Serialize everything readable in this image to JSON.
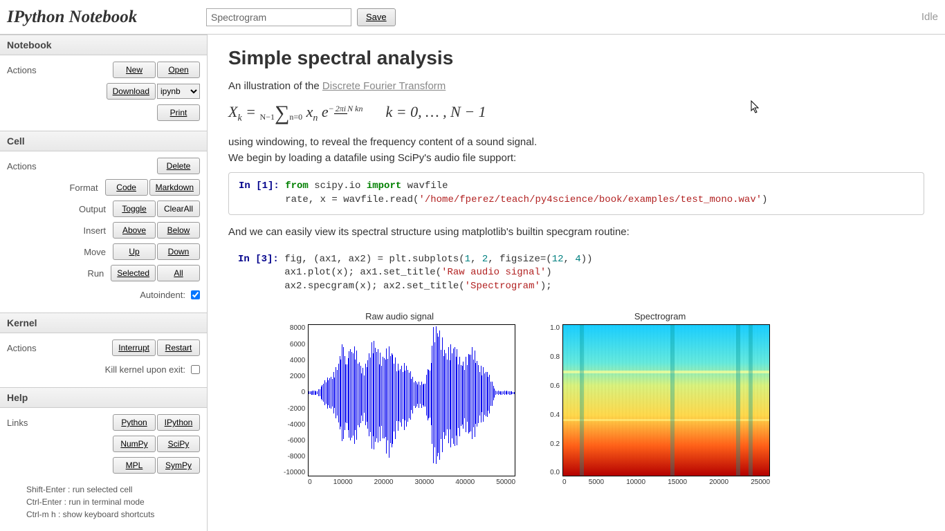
{
  "header": {
    "logo": "IPython Notebook",
    "title_value": "Spectrogram",
    "save_label": "Save",
    "status": "Idle"
  },
  "sidebar": {
    "notebook": {
      "header": "Notebook",
      "actions_label": "Actions",
      "new_label": "New",
      "open_label": "Open",
      "download_label": "Download",
      "download_format": "ipynb",
      "print_label": "Print"
    },
    "cell": {
      "header": "Cell",
      "actions_label": "Actions",
      "delete_label": "Delete",
      "format_label": "Format",
      "code_label": "Code",
      "markdown_label": "Markdown",
      "output_label": "Output",
      "toggle_label": "Toggle",
      "clearall_label": "ClearAll",
      "insert_label": "Insert",
      "above_label": "Above",
      "below_label": "Below",
      "move_label": "Move",
      "up_label": "Up",
      "down_label": "Down",
      "run_label": "Run",
      "selected_label": "Selected",
      "all_label": "All",
      "autoindent_label": "Autoindent:"
    },
    "kernel": {
      "header": "Kernel",
      "actions_label": "Actions",
      "interrupt_label": "Interrupt",
      "restart_label": "Restart",
      "kill_label": "Kill kernel upon exit:"
    },
    "help": {
      "header": "Help",
      "links_label": "Links",
      "python": "Python",
      "ipython": "IPython",
      "numpy": "NumPy",
      "scipy": "SciPy",
      "mpl": "MPL",
      "sympy": "SymPy",
      "hint1": "Shift-Enter : run selected cell",
      "hint2": "Ctrl-Enter : run in terminal mode",
      "hint3": "Ctrl-m h : show keyboard shortcuts"
    }
  },
  "document": {
    "title": "Simple spectral analysis",
    "intro_pre": "An illustration of the ",
    "intro_link": "Discrete Fourier Transform",
    "body1": "using windowing, to reveal the frequency content of a sound signal.",
    "body2": "We begin by loading a datafile using SciPy's audio file support:",
    "body3": "And we can easily view its spectral structure using matplotlib's builtin specgram routine:",
    "cell1": {
      "prompt": "In [1]: ",
      "kw1": "from",
      "mod1": " scipy.io ",
      "kw2": "import",
      "mod2": " wavfile",
      "line2_pre": "        rate, x = wavfile.read(",
      "str": "'/home/fperez/teach/py4science/book/examples/test_mono.wav'",
      "line2_post": ")"
    },
    "cell2": {
      "prompt": "In [3]: ",
      "l1a": "fig, (ax1, ax2) = plt.subplots(",
      "n1": "1",
      "c1": ", ",
      "n2": "2",
      "c2": ", figsize=(",
      "n3": "12",
      "c3": ", ",
      "n4": "4",
      "l1b": "))",
      "l2a": "        ax1.plot(x); ax1.set_title(",
      "s1": "'Raw audio signal'",
      "l2b": ")",
      "l3a": "        ax2.specgram(x); ax2.set_title(",
      "s2": "'Spectrogram'",
      "l3b": ");"
    }
  },
  "chart_data": [
    {
      "type": "line",
      "title": "Raw audio signal",
      "xlim": [
        0,
        50000
      ],
      "ylim": [
        -10000,
        8000
      ],
      "xticks": [
        0,
        10000,
        20000,
        30000,
        40000,
        50000
      ],
      "yticks": [
        8000,
        6000,
        4000,
        2000,
        0,
        -2000,
        -4000,
        -6000,
        -8000,
        -10000
      ],
      "envelope_x": [
        0,
        2000,
        5000,
        8000,
        10000,
        13000,
        16000,
        19000,
        22000,
        25000,
        28000,
        30000,
        33000,
        36000,
        39000,
        42000,
        45000,
        48000,
        50000
      ],
      "envelope_pos": [
        200,
        300,
        2000,
        5000,
        5500,
        3500,
        6000,
        5000,
        4000,
        2000,
        1000,
        7500,
        6500,
        4500,
        5000,
        3500,
        300,
        200,
        200
      ],
      "envelope_neg": [
        -200,
        -300,
        -2000,
        -5000,
        -6000,
        -4000,
        -6500,
        -7000,
        -5000,
        -2500,
        -1500,
        -8000,
        -7000,
        -5500,
        -5000,
        -4000,
        -300,
        -200,
        -200
      ]
    },
    {
      "type": "heatmap",
      "title": "Spectrogram",
      "xlim": [
        0,
        25000
      ],
      "ylim": [
        0.0,
        1.0
      ],
      "xticks": [
        0,
        5000,
        10000,
        15000,
        20000,
        25000
      ],
      "yticks": [
        "1.0",
        "0.8",
        "0.6",
        "0.4",
        "0.2",
        "0.0"
      ],
      "color_low": "#00a0ff",
      "color_mid": "#ffe000",
      "color_high": "#c00000"
    }
  ]
}
